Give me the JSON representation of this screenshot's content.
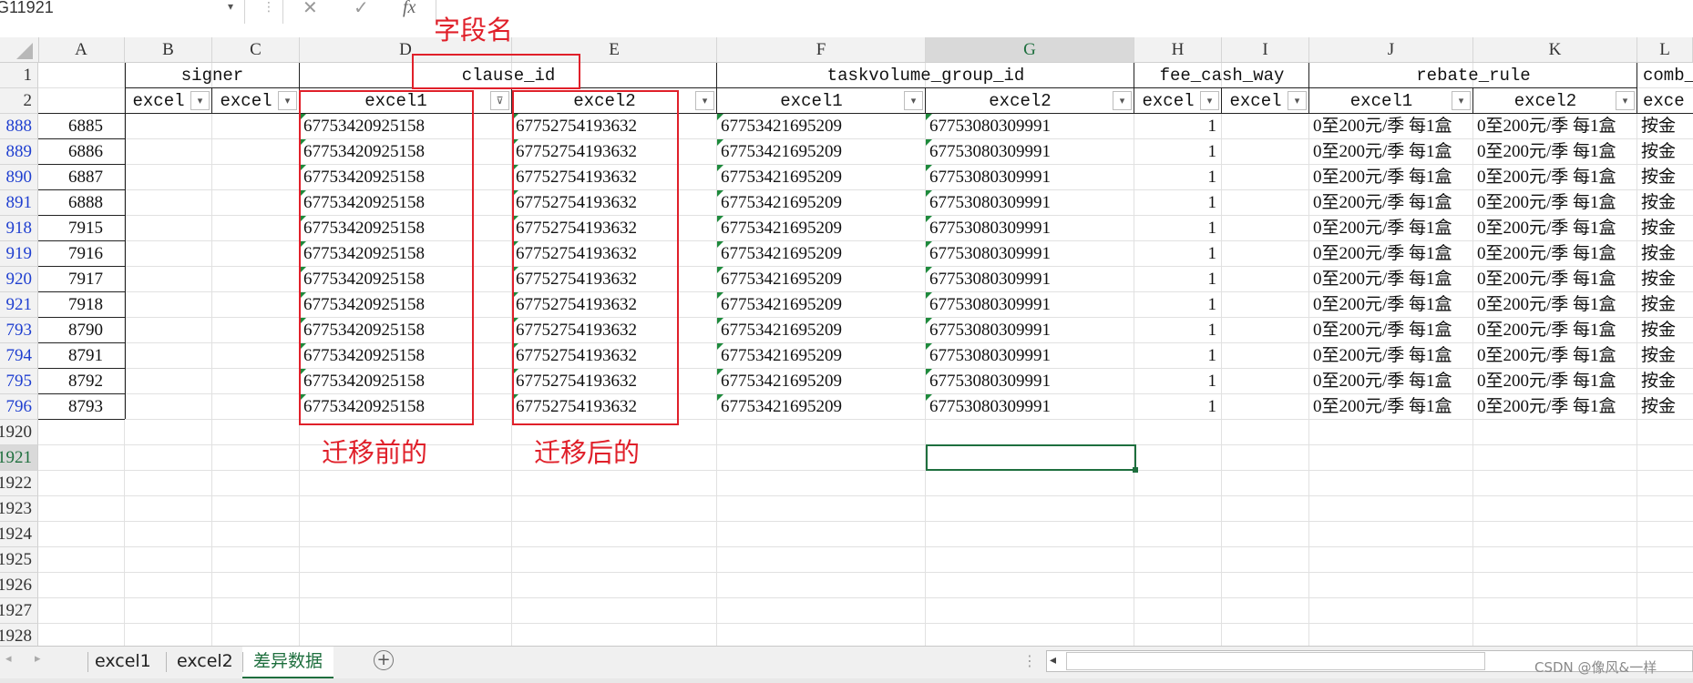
{
  "formula_bar": {
    "name_box": "G11921",
    "cancel_icon": "✕",
    "enter_icon": "✓",
    "fx_label": "fx"
  },
  "columns": [
    "A",
    "B",
    "C",
    "D",
    "E",
    "F",
    "G",
    "H",
    "I",
    "J",
    "K",
    "L"
  ],
  "row_numbers": [
    "1",
    "2",
    "888",
    "889",
    "890",
    "891",
    "918",
    "919",
    "920",
    "921",
    "793",
    "794",
    "795",
    "796",
    "1920",
    "1921",
    "1922",
    "1923",
    "1924",
    "1925",
    "1926",
    "1927",
    "1928"
  ],
  "header_row1": {
    "signer": "signer",
    "clause_id": "clause_id",
    "taskvolume_group_id": "taskvolume_group_id",
    "fee_cash_way": "fee_cash_way",
    "rebate_rule": "rebate_rule",
    "comb": "comb_"
  },
  "header_row2": {
    "b": "excel",
    "c": "excel",
    "d": "excel1",
    "e": "excel2",
    "f": "excel1",
    "g": "excel2",
    "h": "excel",
    "i": "excel",
    "j": "excel1",
    "k": "excel2",
    "l": "exce"
  },
  "rows": [
    {
      "a": "6885",
      "d": "67753420925158",
      "e": "67752754193632",
      "f": "67753421695209",
      "g": "67753080309991",
      "h": "1",
      "j": "0至200元/季  每1盒",
      "k": "0至200元/季  每1盒",
      "l": "按金"
    },
    {
      "a": "6886",
      "d": "67753420925158",
      "e": "67752754193632",
      "f": "67753421695209",
      "g": "67753080309991",
      "h": "1",
      "j": "0至200元/季  每1盒",
      "k": "0至200元/季  每1盒",
      "l": "按金"
    },
    {
      "a": "6887",
      "d": "67753420925158",
      "e": "67752754193632",
      "f": "67753421695209",
      "g": "67753080309991",
      "h": "1",
      "j": "0至200元/季  每1盒",
      "k": "0至200元/季  每1盒",
      "l": "按金"
    },
    {
      "a": "6888",
      "d": "67753420925158",
      "e": "67752754193632",
      "f": "67753421695209",
      "g": "67753080309991",
      "h": "1",
      "j": "0至200元/季  每1盒",
      "k": "0至200元/季  每1盒",
      "l": "按金"
    },
    {
      "a": "7915",
      "d": "67753420925158",
      "e": "67752754193632",
      "f": "67753421695209",
      "g": "67753080309991",
      "h": "1",
      "j": "0至200元/季  每1盒",
      "k": "0至200元/季  每1盒",
      "l": "按金"
    },
    {
      "a": "7916",
      "d": "67753420925158",
      "e": "67752754193632",
      "f": "67753421695209",
      "g": "67753080309991",
      "h": "1",
      "j": "0至200元/季  每1盒",
      "k": "0至200元/季  每1盒",
      "l": "按金"
    },
    {
      "a": "7917",
      "d": "67753420925158",
      "e": "67752754193632",
      "f": "67753421695209",
      "g": "67753080309991",
      "h": "1",
      "j": "0至200元/季  每1盒",
      "k": "0至200元/季  每1盒",
      "l": "按金"
    },
    {
      "a": "7918",
      "d": "67753420925158",
      "e": "67752754193632",
      "f": "67753421695209",
      "g": "67753080309991",
      "h": "1",
      "j": "0至200元/季  每1盒",
      "k": "0至200元/季  每1盒",
      "l": "按金"
    },
    {
      "a": "8790",
      "d": "67753420925158",
      "e": "67752754193632",
      "f": "67753421695209",
      "g": "67753080309991",
      "h": "1",
      "j": "0至200元/季  每1盒",
      "k": "0至200元/季  每1盒",
      "l": "按金"
    },
    {
      "a": "8791",
      "d": "67753420925158",
      "e": "67752754193632",
      "f": "67753421695209",
      "g": "67753080309991",
      "h": "1",
      "j": "0至200元/季  每1盒",
      "k": "0至200元/季  每1盒",
      "l": "按金"
    },
    {
      "a": "8792",
      "d": "67753420925158",
      "e": "67752754193632",
      "f": "67753421695209",
      "g": "67753080309991",
      "h": "1",
      "j": "0至200元/季  每1盒",
      "k": "0至200元/季  每1盒",
      "l": "按金"
    },
    {
      "a": "8793",
      "d": "67753420925158",
      "e": "67752754193632",
      "f": "67753421695209",
      "g": "67753080309991",
      "h": "1",
      "j": "0至200元/季  每1盒",
      "k": "0至200元/季  每1盒",
      "l": "按金"
    }
  ],
  "annotations": {
    "field_name": "字段名",
    "before_migration": "迁移前的",
    "after_migration": "迁移后的"
  },
  "sheet_tabs": [
    {
      "label": "excel1",
      "active": false
    },
    {
      "label": "excel2",
      "active": false
    },
    {
      "label": "差异数据",
      "active": true
    }
  ],
  "add_sheet": "+",
  "watermark": "CSDN @像风&一样",
  "colors": {
    "accent": "#1e6f3e",
    "annotation_red": "#e0202a",
    "row_link_blue": "#1f3fd0",
    "header_bg": "#f2f2f2"
  }
}
